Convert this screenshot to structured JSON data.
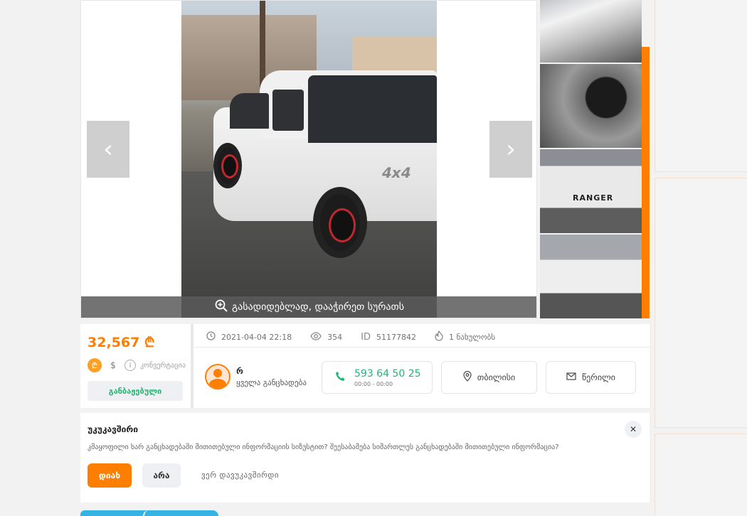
{
  "gallery": {
    "zoom_text": "გასადიდებლად, დააჭირეთ სურათს",
    "prev_arrow": "‹",
    "next_arrow": "›",
    "thumbnail_plate": "RANGER",
    "badge": "4x4"
  },
  "listing": {
    "price": "32,567 ₾",
    "currency_gel": "₾",
    "currency_usd": "$",
    "info_glyph": "i",
    "conversion_label": "კონვერტაცია",
    "customs_status": "განბაჟებული",
    "date": "2021-04-04 22:18",
    "views": "354",
    "id_label": "ID",
    "id_value": "51177842",
    "bump_count": "1 ნახულობს"
  },
  "seller": {
    "name": "რ",
    "all_listings": "ყველა განცხადება",
    "phone": "593 64 50 25",
    "phone_hours": "00:00 - 00:00",
    "location": "თბილისი",
    "message": "წერილი"
  },
  "feedback": {
    "title": "უკუკავშირი",
    "question": "კმაყოფილი ხარ განცხადებაში მითითებული ინფორმაციის სიზუსტით? შეესაბამება სიმართლეს განცხადებაში მითითებული ინფორმაცია?",
    "yes": "დიახ",
    "no": "არა",
    "unsure": "ვერ დავუკავშირდი",
    "close": "✕"
  },
  "colors": {
    "accent": "#fe7f00",
    "green": "#22b573",
    "blue_tab": "#35b4e4"
  },
  "icons": {
    "zoom": "zoom-in-icon",
    "clock": "clock-icon",
    "eye": "eye-icon",
    "fire": "fire-icon",
    "phone": "phone-icon",
    "location": "location-pin-icon",
    "mail": "mail-icon"
  }
}
